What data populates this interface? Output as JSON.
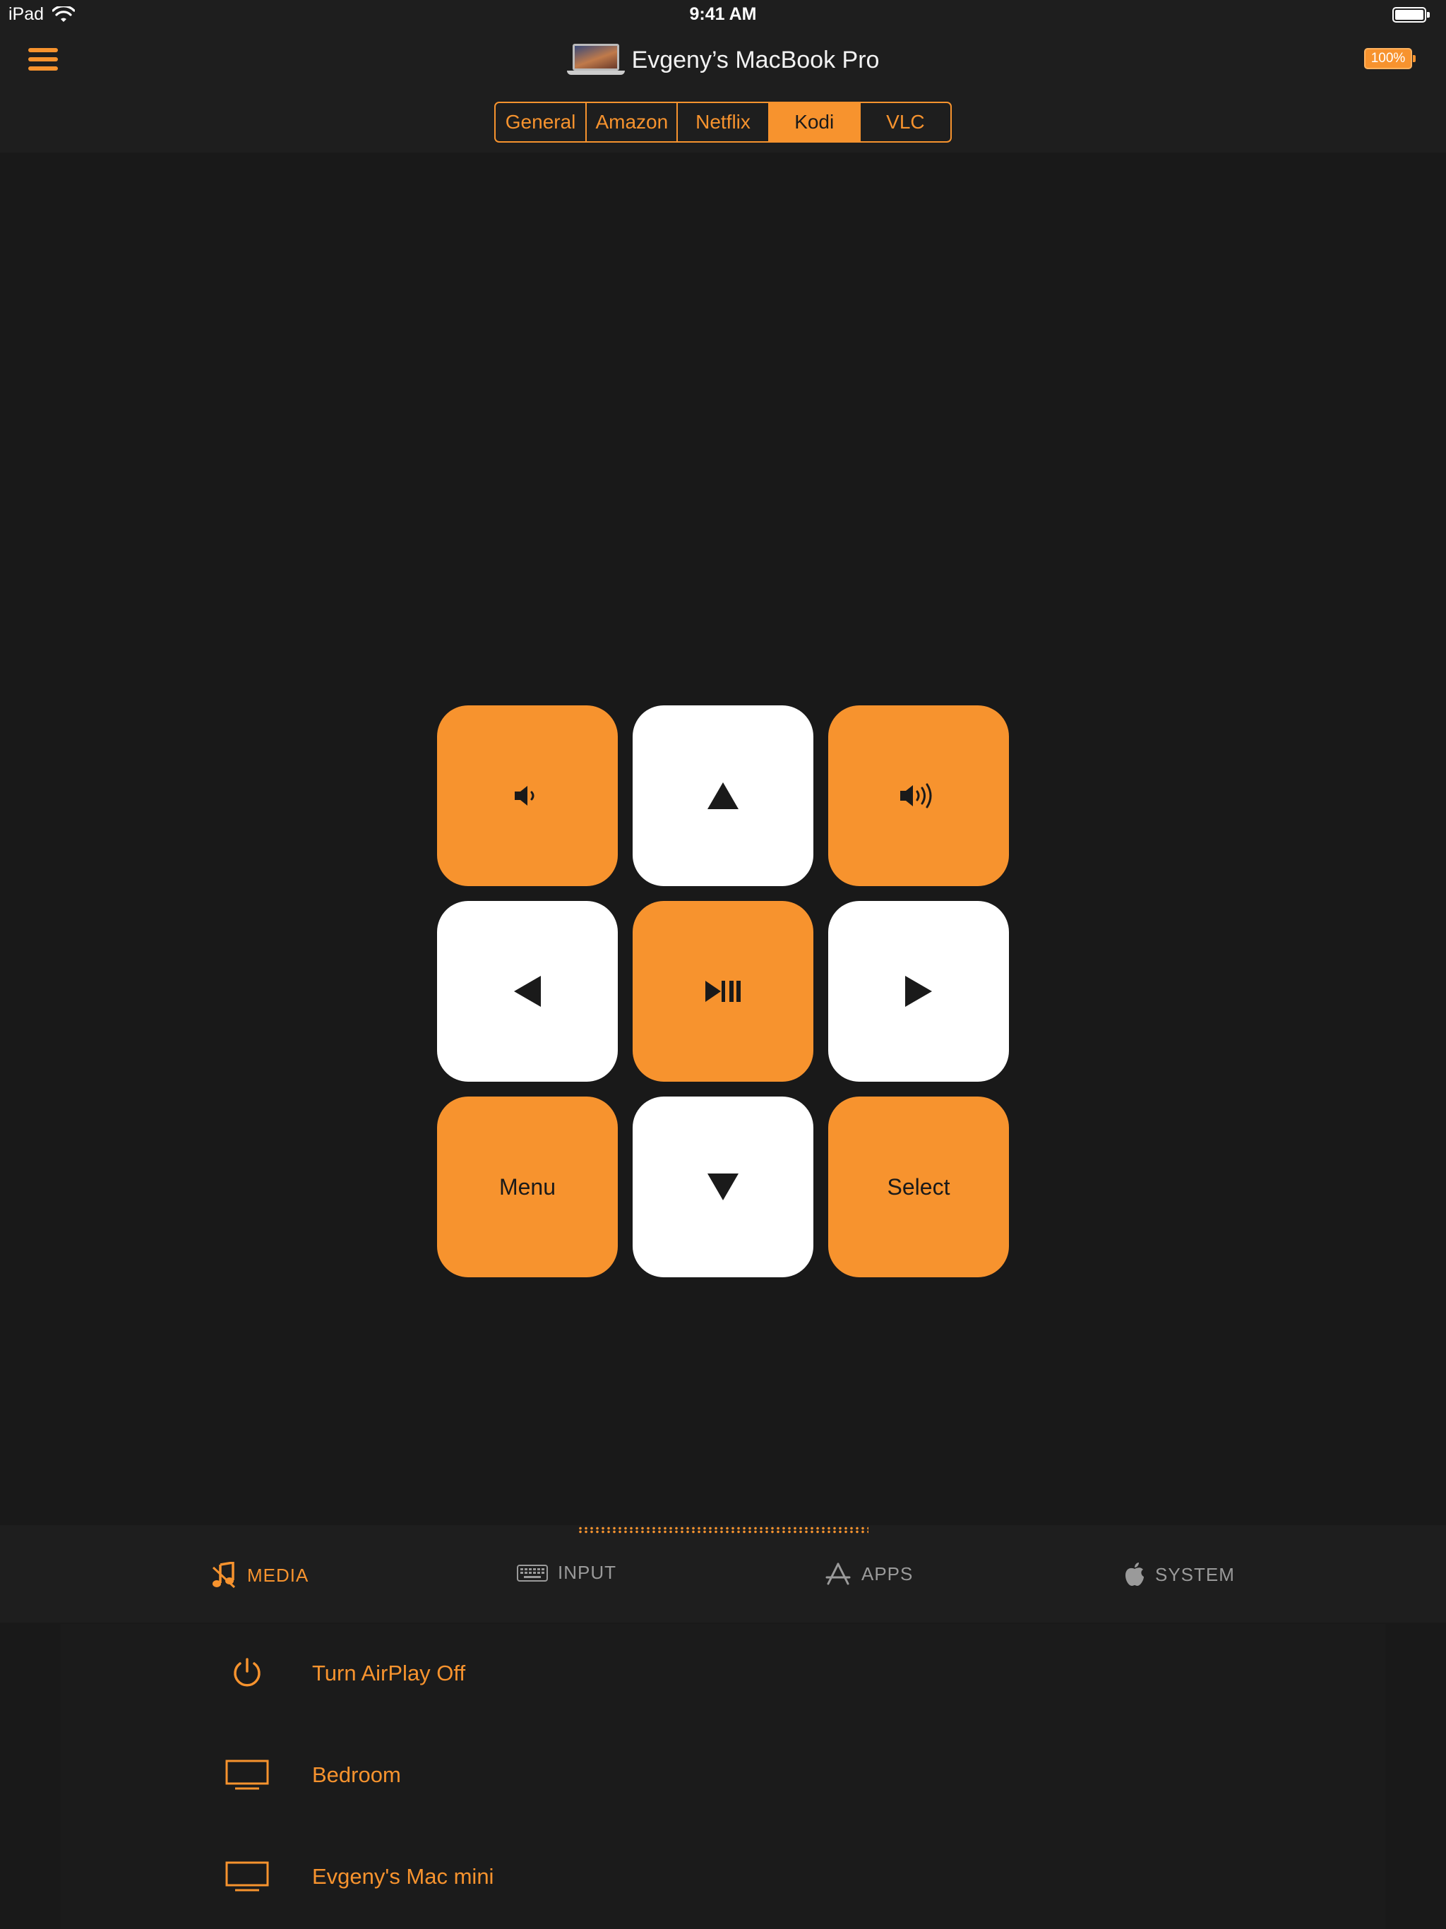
{
  "status_bar": {
    "device": "iPad",
    "time": "9:41 AM"
  },
  "nav": {
    "title": "Evgeny’s MacBook Pro",
    "battery": "100%"
  },
  "segments": [
    {
      "label": "General",
      "active": false
    },
    {
      "label": "Amazon",
      "active": false
    },
    {
      "label": "Netflix",
      "active": false
    },
    {
      "label": "Kodi",
      "active": true
    },
    {
      "label": "VLC",
      "active": false
    }
  ],
  "pad": {
    "volume_down_icon": "speaker-low-icon",
    "up_icon": "triangle-up-icon",
    "volume_up_icon": "speaker-high-icon",
    "left_icon": "triangle-left-icon",
    "play_pause_icon": "play-pause-icon",
    "right_icon": "triangle-right-icon",
    "menu_label": "Menu",
    "down_icon": "triangle-down-icon",
    "select_label": "Select"
  },
  "tabs": [
    {
      "label": "MEDIA",
      "icon": "music-note-icon",
      "active": true
    },
    {
      "label": "INPUT",
      "icon": "keyboard-icon",
      "active": false
    },
    {
      "label": "APPS",
      "icon": "app-store-icon",
      "active": false
    },
    {
      "label": "SYSTEM",
      "icon": "apple-logo-icon",
      "active": false
    }
  ],
  "list": [
    {
      "label": "Turn AirPlay Off",
      "icon": "power-icon"
    },
    {
      "label": "Bedroom",
      "icon": "tv-icon"
    },
    {
      "label": "Evgeny's Mac mini",
      "icon": "tv-icon"
    }
  ],
  "colors": {
    "accent": "#f7932e",
    "background": "#191919",
    "bar_background": "#1e1e1e",
    "button_white": "#ffffff"
  }
}
